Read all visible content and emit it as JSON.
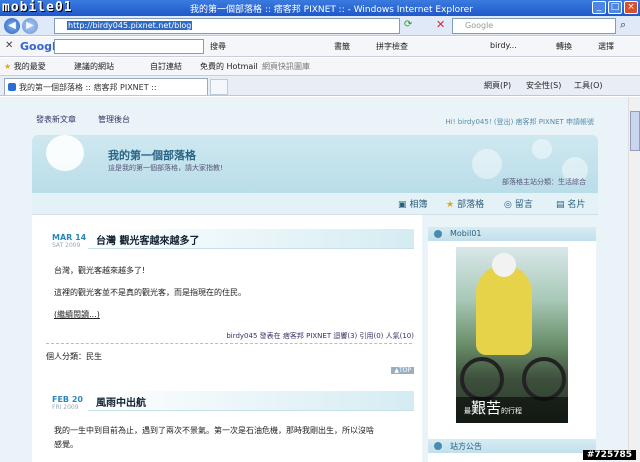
{
  "window": {
    "title": "我的第一個部落格 :: 痞客邦 PIXNET :: - Windows Internet Explorer",
    "logo": "mobile01"
  },
  "address": {
    "url": "http://birdy045.pixnet.net/blog",
    "search_placeholder": "Google"
  },
  "google_bar": {
    "logo": "Google",
    "search_label": "搜尋",
    "bookmarks_label": "書籤",
    "spell_label": "拼字檢查",
    "user_label": "birdy...",
    "translate_label": "轉換",
    "options_label": "選擇"
  },
  "favorites": {
    "fav_label": "我的最愛",
    "items": [
      "建議的網站",
      "自訂連結",
      "免費的 Hotmail",
      "網頁快訊圖庫"
    ]
  },
  "tab": {
    "title": "我的第一個部落格 :: 痞客邦 PIXNET ::"
  },
  "tools": {
    "page": "網頁(P)",
    "safety": "安全性(S)",
    "tools": "工具(O)"
  },
  "topbar": {
    "new_post": "發表新文章",
    "admin": "管理後台",
    "greeting": "Hi! birdy045! (登出) 痞客邦 PIXNET 申請帳號"
  },
  "header": {
    "blog_title": "我的第一個部落格",
    "subtitle": "這是我的第一個部落格，請大家指教!",
    "category": "部落格主站分類：生活綜合"
  },
  "nav": {
    "album": "相簿",
    "blog": "部落格",
    "guestbook": "留言",
    "card": "名片"
  },
  "posts": [
    {
      "month": "MAR 14",
      "year": "SAT 2009",
      "title": "台灣 觀光客越來越多了",
      "lines": [
        "台灣，觀光客越來越多了!",
        "這裡的觀光客並不是真的觀光客，而是指現在的住民。",
        "(繼續閱讀...)"
      ],
      "meta": "birdy045 發表在 痞客邦 PIXNET 迴響(3) 引用(0) 人氣(10)",
      "category": "個人分類：民生",
      "top": "▲TOP"
    },
    {
      "month": "FEB 20",
      "year": "FRI 2009",
      "title": "風雨中出航",
      "lines": [
        "我的一生中到目前為止，遇到了兩次不景氣。第一次是石油危機，那時我剛出生，所以沒啥",
        "感覺。"
      ]
    }
  ],
  "sidebar": {
    "mobil_title": "Mobil01",
    "caption_small": "最",
    "caption_big": "艱苦",
    "caption_tail": "的行程",
    "notice_title": "站方公告"
  },
  "watermark": "#725785"
}
